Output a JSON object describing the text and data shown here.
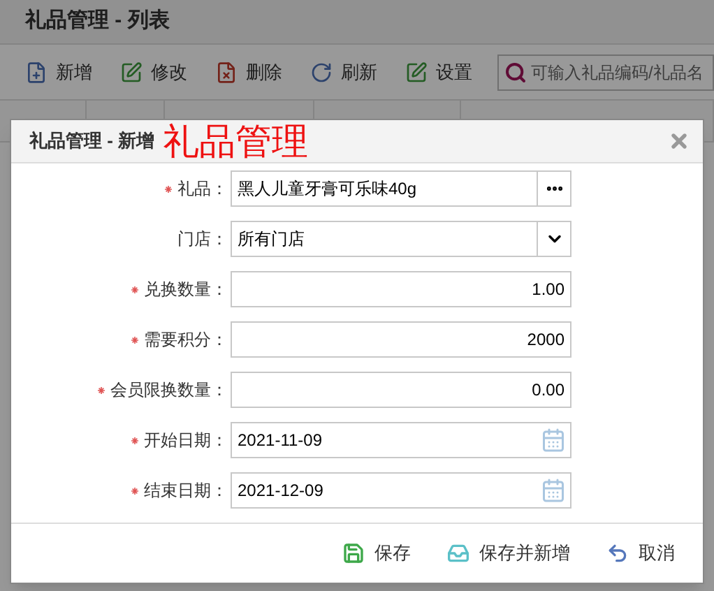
{
  "page": {
    "title": "礼品管理 - 列表",
    "toolbar": [
      {
        "label": "新增",
        "kind": "add"
      },
      {
        "label": "修改",
        "kind": "edit"
      },
      {
        "label": "删除",
        "kind": "delete"
      },
      {
        "label": "刷新",
        "kind": "refresh"
      },
      {
        "label": "设置",
        "kind": "settings"
      }
    ],
    "search": {
      "placeholder": "可输入礼品编码/礼品名"
    }
  },
  "dialog": {
    "title": "礼品管理 - 新增",
    "annotation": "礼品管理",
    "fields": [
      {
        "label": "礼品：",
        "required": true,
        "kind": "picker",
        "value": "黑人儿童牙膏可乐味40g"
      },
      {
        "label": "门店：",
        "required": false,
        "kind": "select",
        "value": "所有门店"
      },
      {
        "label": "兑换数量：",
        "required": true,
        "kind": "number",
        "value": "1.00"
      },
      {
        "label": "需要积分：",
        "required": true,
        "kind": "number",
        "value": "2000"
      },
      {
        "label": "会员限换数量：",
        "required": true,
        "kind": "number",
        "value": "0.00"
      },
      {
        "label": "开始日期：",
        "required": true,
        "kind": "date",
        "value": "2021-11-09"
      },
      {
        "label": "结束日期：",
        "required": true,
        "kind": "date",
        "value": "2021-12-09"
      }
    ],
    "buttons": [
      {
        "label": "保存",
        "kind": "save"
      },
      {
        "label": "保存并新增",
        "kind": "save_new"
      },
      {
        "label": "取消",
        "kind": "cancel"
      }
    ]
  }
}
